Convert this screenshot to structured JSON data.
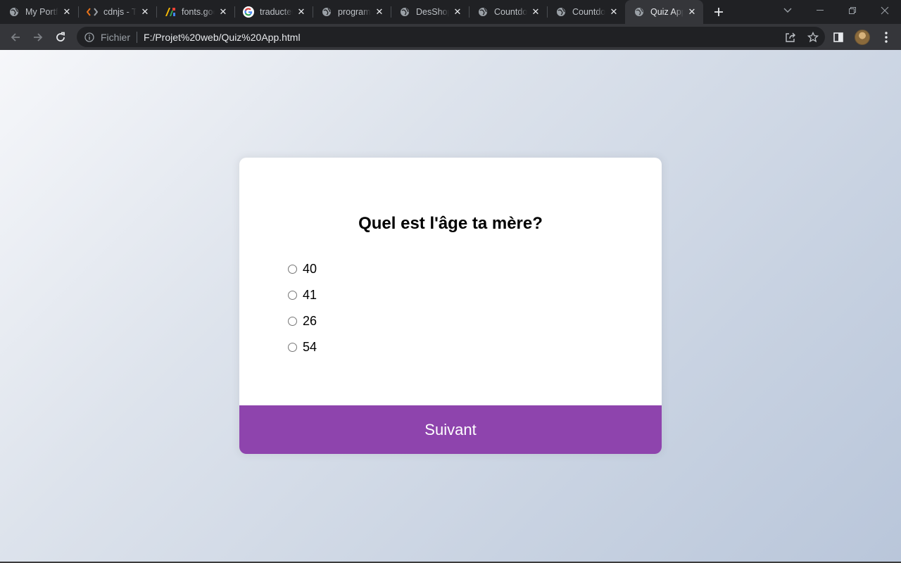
{
  "browser": {
    "tabs": [
      {
        "title": "My Portfolio",
        "favicon": "globe-icon"
      },
      {
        "title": "cdnjs - The",
        "favicon": "code-brackets-icon"
      },
      {
        "title": "fonts.google",
        "favicon": "google-fonts-icon"
      },
      {
        "title": "traducteur",
        "favicon": "google-g-icon"
      },
      {
        "title": "programme",
        "favicon": "globe-icon"
      },
      {
        "title": "DesShop",
        "favicon": "globe-icon"
      },
      {
        "title": "Countdown",
        "favicon": "globe-icon"
      },
      {
        "title": "Countdown",
        "favicon": "globe-icon"
      },
      {
        "title": "Quiz App",
        "favicon": "globe-icon",
        "active": true
      }
    ],
    "omnibox": {
      "scheme_label": "Fichier",
      "url": "F:/Projet%20web/Quiz%20App.html"
    }
  },
  "quiz": {
    "question": "Quel est l'âge ta mère?",
    "answers": [
      "40",
      "41",
      "26",
      "54"
    ],
    "submit_label": "Suivant"
  },
  "colors": {
    "accent": "#8e44ad",
    "card": "#ffffff",
    "chrome_dark": "#202124",
    "chrome_toolbar": "#35363a"
  }
}
